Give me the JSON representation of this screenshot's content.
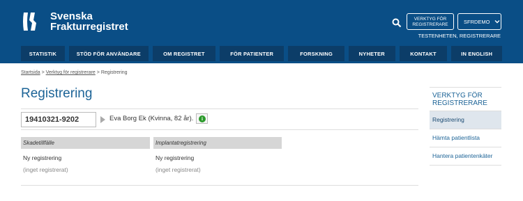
{
  "header": {
    "logo_line1": "Svenska",
    "logo_line2": "Frakturregistret",
    "tools_button": "VERKTYG FÖR REGISTRERARE",
    "user_button": "SFRDEMO",
    "unit_label": "TESTENHETEN, REGISTRERARE",
    "brand_color": "#0a4e86",
    "nav_color": "#0c3d68"
  },
  "nav": {
    "items": [
      {
        "label": "STATISTIK"
      },
      {
        "label": "STÖD FÖR ANVÄNDARE"
      },
      {
        "label": "OM REGISTRET"
      },
      {
        "label": "FÖR PATIENTER"
      },
      {
        "label": "FORSKNING"
      },
      {
        "label": "NYHETER"
      },
      {
        "label": "KONTAKT"
      },
      {
        "label": "IN ENGLISH"
      }
    ]
  },
  "breadcrumb": {
    "items": [
      "Startsida",
      "Verktyg för registrerare",
      "Registrering"
    ],
    "separator": ">"
  },
  "main": {
    "title": "Registrering",
    "personnummer": "19410321-9202",
    "patient_info": "Eva Borg Ek (Kvinna, 82 år).",
    "info_icon": "i",
    "columns": [
      {
        "header": "Skadetillfälle",
        "link": "Ny registrering",
        "empty": "(inget registrerat)"
      },
      {
        "header": "Implantatregistrering",
        "link": "Ny registrering",
        "empty": "(inget registrerat)"
      }
    ]
  },
  "sidebar": {
    "title": "VERKTYG FÖR REGISTRERARE",
    "items": [
      {
        "label": "Registrering",
        "active": true
      },
      {
        "label": "Hämta patientlista",
        "active": false
      },
      {
        "label": "Hantera patientenkäter",
        "active": false
      }
    ]
  }
}
